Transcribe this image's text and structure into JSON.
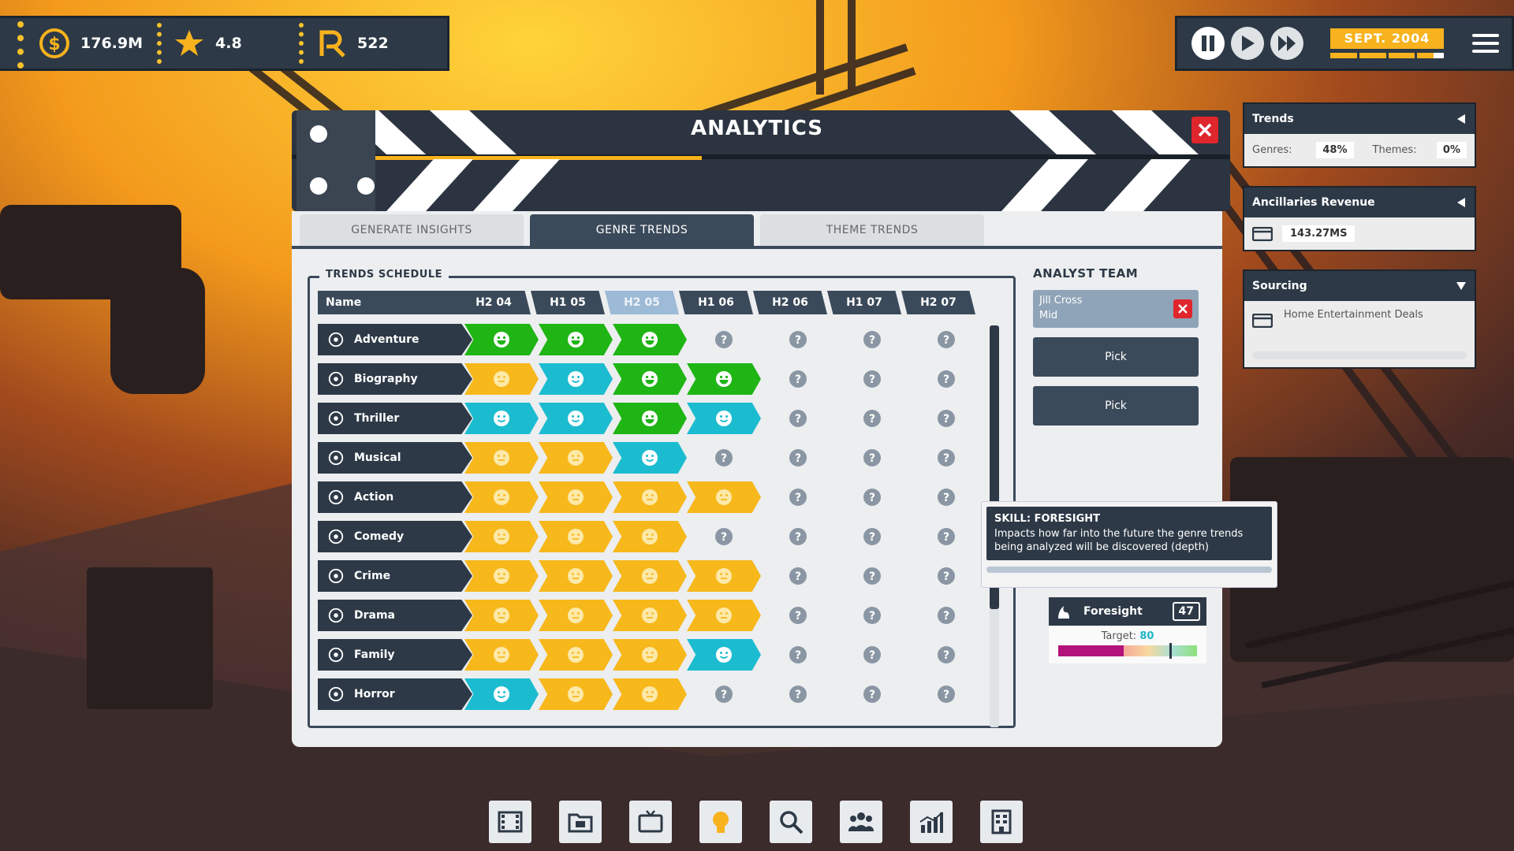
{
  "resources": [
    {
      "name": "money",
      "icon": "money-icon",
      "value": "176.9M"
    },
    {
      "name": "rating",
      "icon": "star-icon",
      "value": "4.8"
    },
    {
      "name": "influence",
      "icon": "influence-icon",
      "value": "522"
    }
  ],
  "time": {
    "date": "SEPT. 2004",
    "controls": [
      "pause",
      "play",
      "fast-forward"
    ],
    "active": "pause"
  },
  "window": {
    "title": "ANALYTICS"
  },
  "tabs": [
    {
      "label": "GENERATE INSIGHTS",
      "active": false
    },
    {
      "label": "GENRE TRENDS",
      "active": true
    },
    {
      "label": "THEME TRENDS",
      "active": false
    }
  ],
  "schedule": {
    "title": "TRENDS SCHEDULE",
    "name_header": "Name",
    "periods": [
      "H2 04",
      "H1 05",
      "H2 05",
      "H1 06",
      "H2 06",
      "H1 07",
      "H2 07"
    ],
    "highlighted_period": "H2 05",
    "rows": [
      {
        "genre": "Adventure",
        "icon": "compass-icon",
        "trends": [
          "great",
          "great",
          "great",
          "unknown",
          "unknown",
          "unknown",
          "unknown"
        ]
      },
      {
        "genre": "Biography",
        "icon": "statue-icon",
        "trends": [
          "neutral",
          "good",
          "great",
          "great",
          "unknown",
          "unknown",
          "unknown"
        ]
      },
      {
        "genre": "Thriller",
        "icon": "keyhole-icon",
        "trends": [
          "good",
          "good",
          "great",
          "good",
          "unknown",
          "unknown",
          "unknown"
        ]
      },
      {
        "genre": "Musical",
        "icon": "music-note-icon",
        "trends": [
          "neutral",
          "neutral",
          "good",
          "unknown",
          "unknown",
          "unknown",
          "unknown"
        ]
      },
      {
        "genre": "Action",
        "icon": "explosion-icon",
        "trends": [
          "neutral",
          "neutral",
          "neutral",
          "neutral",
          "unknown",
          "unknown",
          "unknown"
        ]
      },
      {
        "genre": "Comedy",
        "icon": "comedy-icon",
        "trends": [
          "neutral",
          "neutral",
          "neutral",
          "unknown",
          "unknown",
          "unknown",
          "unknown"
        ]
      },
      {
        "genre": "Crime",
        "icon": "crime-icon",
        "trends": [
          "neutral",
          "neutral",
          "neutral",
          "neutral",
          "unknown",
          "unknown",
          "unknown"
        ]
      },
      {
        "genre": "Drama",
        "icon": "drama-mask-icon",
        "trends": [
          "neutral",
          "neutral",
          "neutral",
          "neutral",
          "unknown",
          "unknown",
          "unknown"
        ]
      },
      {
        "genre": "Family",
        "icon": "family-icon",
        "trends": [
          "neutral",
          "neutral",
          "neutral",
          "good",
          "unknown",
          "unknown",
          "unknown"
        ]
      },
      {
        "genre": "Horror",
        "icon": "horror-icon",
        "trends": [
          "good",
          "neutral",
          "neutral",
          "unknown",
          "unknown",
          "unknown",
          "unknown"
        ]
      }
    ]
  },
  "trend_colors": {
    "great": "#1fb515",
    "good": "#1cbcd0",
    "neutral": "#f7b81c"
  },
  "analyst_team": {
    "title": "ANALYST TEAM",
    "members": [
      {
        "name": "Jill Cross",
        "level": "Mid"
      }
    ],
    "pick_label": "Pick",
    "pick_slots": 2
  },
  "tooltip": {
    "title": "SKILL: FORESIGHT",
    "text": "Impacts how far into the future the genre trends being analyzed will be discovered (depth)"
  },
  "skill": {
    "name": "Foresight",
    "value": "47",
    "target_label": "Target:",
    "target_value": "80",
    "value_fraction": 0.47,
    "target_fraction": 0.8
  },
  "side_panels": {
    "trends": {
      "title": "Trends",
      "genres_label": "Genres:",
      "genres_value": "48%",
      "themes_label": "Themes:",
      "themes_value": "0%"
    },
    "ancillaries": {
      "title": "Ancillaries Revenue",
      "value": "143.27MS"
    },
    "sourcing": {
      "title": "Sourcing",
      "item": "Home Entertainment Deals"
    }
  },
  "toolbar": [
    "film-reel-icon",
    "folder-icon",
    "tv-icon",
    "lightbulb-icon",
    "search-icon",
    "people-icon",
    "chart-icon",
    "building-icon"
  ],
  "toolbar_active": "lightbulb-icon"
}
